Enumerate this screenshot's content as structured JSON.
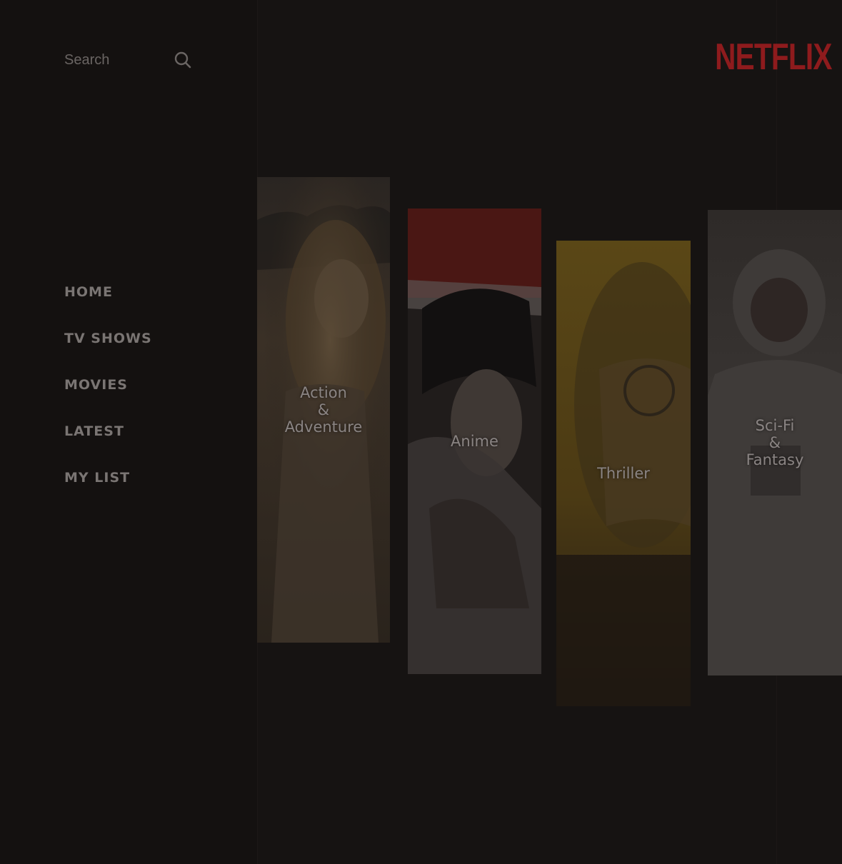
{
  "app": {
    "logo": "NETFLIX",
    "brand_color": "#8e1b1d",
    "background_color": "#161312"
  },
  "search": {
    "label": "Search",
    "icon": "search-icon"
  },
  "nav": {
    "items": [
      {
        "label": "HOME"
      },
      {
        "label": "TV SHOWS"
      },
      {
        "label": "MOVIES"
      },
      {
        "label": "LATEST"
      },
      {
        "label": "MY LIST"
      }
    ]
  },
  "genres": {
    "items": [
      {
        "label": "Action\n&\nAdventure"
      },
      {
        "label": "Anime"
      },
      {
        "label": "Thriller"
      },
      {
        "label": "Sci-Fi\n&\nFantasy"
      }
    ]
  }
}
